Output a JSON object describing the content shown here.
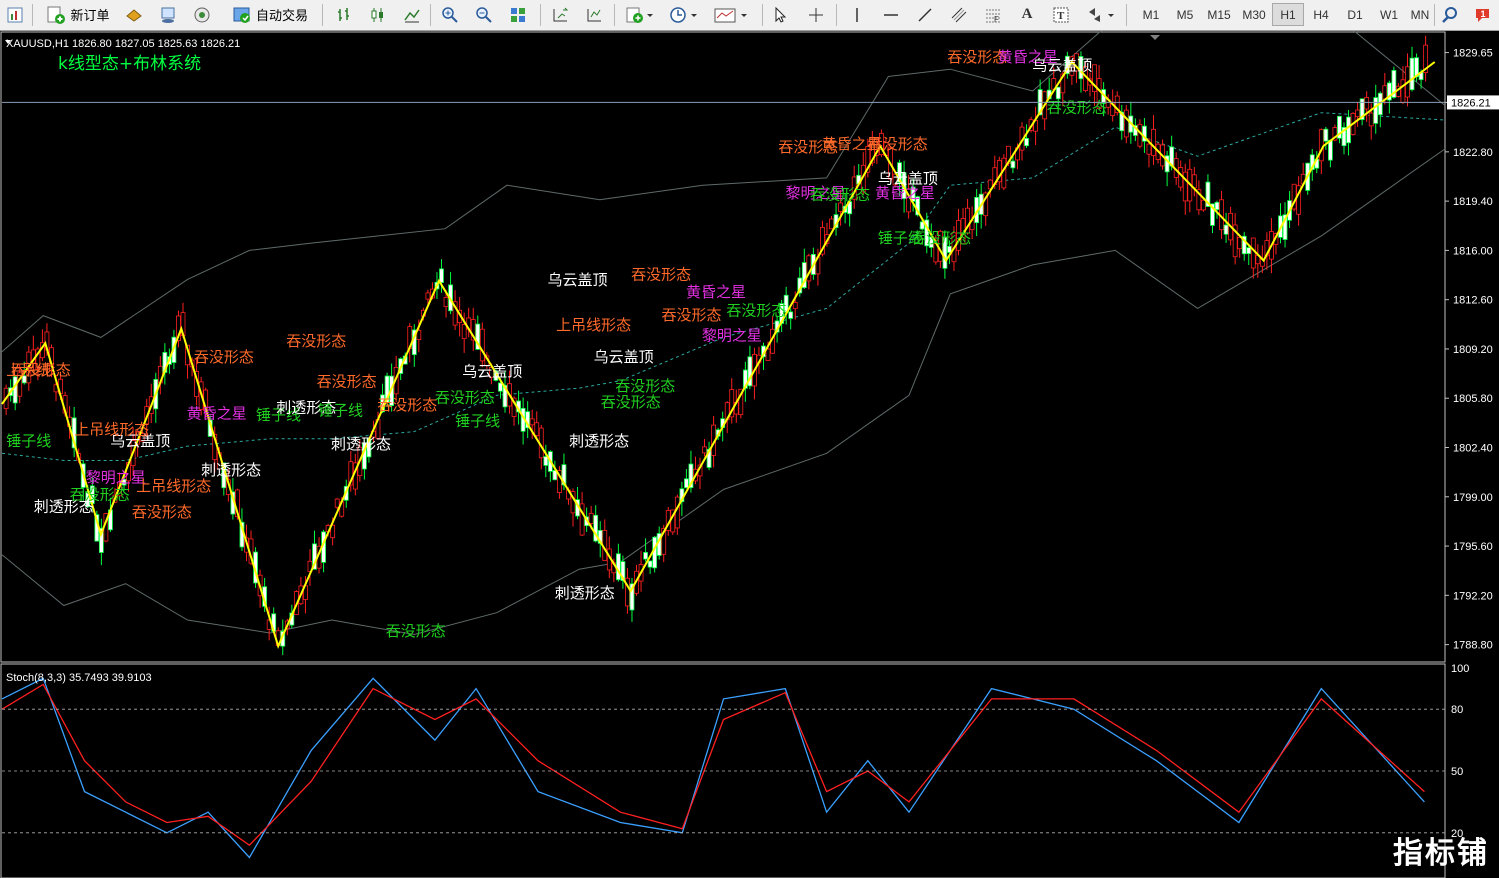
{
  "toolbar": {
    "new_order_label": "新订单",
    "auto_trade_label": "自动交易",
    "timeframes": [
      "M1",
      "M5",
      "M15",
      "M30",
      "H1",
      "H4",
      "D1",
      "W1",
      "MN"
    ]
  },
  "chart": {
    "symbol_info": "XAUUSD,H1  1826.80 1827.05 1825.63 1826.21",
    "indicator_title": "k线型态+布林系统",
    "current_price_label": "1826.21",
    "current_price": 1826.21,
    "price_ticks": [
      "1829.65",
      "1826.21",
      "1822.80",
      "1819.40",
      "1816.00",
      "1812.60",
      "1809.20",
      "1805.80",
      "1802.40",
      "1799.00",
      "1795.60",
      "1792.20",
      "1788.80"
    ],
    "stoch_title": "Stoch(8,3,3) 35.7493 39.9103",
    "stoch_ticks": [
      "100",
      "80",
      "50",
      "20"
    ]
  },
  "chart_data": {
    "type": "line",
    "title": "k线型态+布林系统",
    "xlabel": "",
    "ylabel": "",
    "ylim": [
      1787.6,
      1831.0
    ],
    "zigzag": {
      "x": [
        0,
        21,
        48,
        87,
        134,
        212,
        305,
        426,
        458,
        519,
        612,
        641,
        695
      ],
      "y": [
        1805.4,
        1809.6,
        1796.4,
        1810.6,
        1788.7,
        1813.9,
        1792.5,
        1823.2,
        1815.3,
        1829.0,
        1815.3,
        1823.2,
        1829.0
      ]
    },
    "upper_band": {
      "x": [
        0,
        20,
        48,
        90,
        120,
        150,
        215,
        245,
        290,
        340,
        400,
        430,
        460,
        500,
        540,
        600,
        640,
        700
      ],
      "y": [
        1809.0,
        1811.5,
        1810.0,
        1814.0,
        1816.0,
        1816.5,
        1817.5,
        1820.5,
        1819.5,
        1820.5,
        1821.0,
        1828.0,
        1828.5,
        1827.0,
        1832.0,
        1834.0,
        1833.0,
        1826.0
      ]
    },
    "lower_band": {
      "x": [
        0,
        30,
        60,
        90,
        130,
        160,
        200,
        240,
        280,
        300,
        350,
        400,
        440,
        460,
        500,
        540,
        580,
        640,
        700
      ],
      "y": [
        1795.0,
        1791.5,
        1793.0,
        1790.5,
        1789.6,
        1790.5,
        1789.5,
        1791.0,
        1794.0,
        1794.5,
        1799.5,
        1802.0,
        1806.0,
        1813.0,
        1815.0,
        1816.0,
        1812.0,
        1817.0,
        1823.0
      ]
    },
    "middle_band": {
      "x": [
        0,
        30,
        60,
        90,
        130,
        160,
        200,
        240,
        280,
        300,
        350,
        400,
        440,
        460,
        500,
        540,
        580,
        640,
        700
      ],
      "y": [
        1802.0,
        1801.5,
        1801.5,
        1802.5,
        1803.0,
        1803.0,
        1803.5,
        1806.0,
        1806.5,
        1807.0,
        1810.0,
        1812.0,
        1816.5,
        1820.5,
        1821.0,
        1824.5,
        1822.5,
        1825.5,
        1825.0
      ]
    },
    "stochastic": {
      "ylim": [
        0,
        100
      ],
      "main": {
        "x": [
          0,
          20,
          40,
          60,
          80,
          100,
          120,
          150,
          180,
          210,
          230,
          260,
          300,
          330,
          350,
          380,
          400,
          420,
          440,
          480,
          520,
          560,
          600,
          640,
          690
        ],
        "y": [
          85,
          95,
          40,
          30,
          20,
          30,
          8,
          60,
          95,
          65,
          90,
          40,
          25,
          20,
          85,
          90,
          30,
          55,
          30,
          90,
          80,
          55,
          25,
          90,
          35
        ]
      },
      "signal": {
        "x": [
          0,
          20,
          40,
          60,
          80,
          100,
          120,
          150,
          180,
          210,
          230,
          260,
          300,
          330,
          350,
          380,
          400,
          420,
          440,
          480,
          520,
          560,
          600,
          640,
          690
        ],
        "y": [
          80,
          92,
          55,
          35,
          25,
          28,
          14,
          45,
          90,
          75,
          85,
          55,
          30,
          22,
          75,
          88,
          40,
          50,
          35,
          85,
          85,
          60,
          30,
          85,
          40
        ]
      }
    }
  },
  "annotations": [
    {
      "text": "吞没形态",
      "x": 0.006,
      "price": 1807.4,
      "color": "#ff6a2a"
    },
    {
      "text": "上吊线",
      "x": 0.003,
      "price": 1807.4,
      "color": "#ff6a2a"
    },
    {
      "text": "锤子线",
      "x": 0.003,
      "price": 1802.5,
      "color": "#20d020"
    },
    {
      "text": "乌云盖顶",
      "x": 0.075,
      "price": 1802.5,
      "color": "#ffffff"
    },
    {
      "text": "上吊线形态",
      "x": 0.05,
      "price": 1803.3,
      "color": "#ff6a2a"
    },
    {
      "text": "黎明之星",
      "x": 0.058,
      "price": 1800.0,
      "color": "#e030e0"
    },
    {
      "text": "刺透形态",
      "x": 0.022,
      "price": 1798.0,
      "color": "#ffffff"
    },
    {
      "text": "吞没形态",
      "x": 0.047,
      "price": 1798.8,
      "color": "#20d020"
    },
    {
      "text": "上吊线形态",
      "x": 0.093,
      "price": 1799.4,
      "color": "#ff6a2a"
    },
    {
      "text": "吞没形态",
      "x": 0.09,
      "price": 1797.6,
      "color": "#ff6a2a"
    },
    {
      "text": "刺透形态",
      "x": 0.138,
      "price": 1800.5,
      "color": "#ffffff"
    },
    {
      "text": "吞没形态",
      "x": 0.133,
      "price": 1808.3,
      "color": "#ff6a2a"
    },
    {
      "text": "黄昏之星",
      "x": 0.128,
      "price": 1804.4,
      "color": "#e030e0"
    },
    {
      "text": "锤子线",
      "x": 0.176,
      "price": 1804.3,
      "color": "#20d020"
    },
    {
      "text": "吞没形态",
      "x": 0.197,
      "price": 1809.4,
      "color": "#ff6a2a"
    },
    {
      "text": "刺透形态",
      "x": 0.19,
      "price": 1804.8,
      "color": "#ffffff"
    },
    {
      "text": "吞没形态",
      "x": 0.218,
      "price": 1806.6,
      "color": "#ff6a2a"
    },
    {
      "text": "锤子线",
      "x": 0.219,
      "price": 1804.6,
      "color": "#20d020"
    },
    {
      "text": "刺透形态",
      "x": 0.228,
      "price": 1802.3,
      "color": "#ffffff"
    },
    {
      "text": "吞没形态",
      "x": 0.26,
      "price": 1805.0,
      "color": "#ff6a2a"
    },
    {
      "text": "吞没形态",
      "x": 0.3,
      "price": 1805.5,
      "color": "#20d020"
    },
    {
      "text": "锤子线",
      "x": 0.314,
      "price": 1803.9,
      "color": "#20d020"
    },
    {
      "text": "乌云盖顶",
      "x": 0.319,
      "price": 1807.3,
      "color": "#ffffff"
    },
    {
      "text": "吞没形态",
      "x": 0.266,
      "price": 1789.4,
      "color": "#20d020"
    },
    {
      "text": "乌云盖顶",
      "x": 0.378,
      "price": 1813.6,
      "color": "#ffffff"
    },
    {
      "text": "上吊线形态",
      "x": 0.384,
      "price": 1810.5,
      "color": "#ff6a2a"
    },
    {
      "text": "乌云盖顶",
      "x": 0.41,
      "price": 1808.3,
      "color": "#ffffff"
    },
    {
      "text": "吞没形态",
      "x": 0.425,
      "price": 1806.3,
      "color": "#20d020"
    },
    {
      "text": "吞没形态",
      "x": 0.415,
      "price": 1805.2,
      "color": "#20d020"
    },
    {
      "text": "刺透形态",
      "x": 0.393,
      "price": 1802.5,
      "color": "#ffffff"
    },
    {
      "text": "刺透形态",
      "x": 0.383,
      "price": 1792.0,
      "color": "#ffffff"
    },
    {
      "text": "吞没形态",
      "x": 0.436,
      "price": 1814.0,
      "color": "#ff6a2a"
    },
    {
      "text": "黄昏之星",
      "x": 0.474,
      "price": 1812.8,
      "color": "#e030e0"
    },
    {
      "text": "吞没形态",
      "x": 0.457,
      "price": 1811.2,
      "color": "#ff6a2a"
    },
    {
      "text": "吞没形态",
      "x": 0.502,
      "price": 1811.5,
      "color": "#20d020"
    },
    {
      "text": "黎明之星",
      "x": 0.485,
      "price": 1809.8,
      "color": "#e030e0"
    },
    {
      "text": "吞没形态",
      "x": 0.538,
      "price": 1822.8,
      "color": "#ff6a2a"
    },
    {
      "text": "黄昏之星",
      "x": 0.568,
      "price": 1823.0,
      "color": "#ff6a2a"
    },
    {
      "text": "吞没形态",
      "x": 0.6,
      "price": 1823.0,
      "color": "#ff6a2a"
    },
    {
      "text": "黎明之星",
      "x": 0.543,
      "price": 1819.6,
      "color": "#e030e0"
    },
    {
      "text": "吞没形态",
      "x": 0.56,
      "price": 1819.5,
      "color": "#20d020"
    },
    {
      "text": "乌云盖顶",
      "x": 0.607,
      "price": 1820.6,
      "color": "#ffffff"
    },
    {
      "text": "黄昏之星",
      "x": 0.605,
      "price": 1819.6,
      "color": "#e030e0"
    },
    {
      "text": "锤子线",
      "x": 0.607,
      "price": 1816.5,
      "color": "#20d020"
    },
    {
      "text": "吞没形态",
      "x": 0.63,
      "price": 1816.5,
      "color": "#20d020"
    },
    {
      "text": "吞没形态",
      "x": 0.655,
      "price": 1829.0,
      "color": "#ff6a2a"
    },
    {
      "text": "黄昏之星",
      "x": 0.69,
      "price": 1829.0,
      "color": "#e030e0"
    },
    {
      "text": "乌云盖顶",
      "x": 0.714,
      "price": 1828.4,
      "color": "#ffffff"
    },
    {
      "text": "吞没形态",
      "x": 0.724,
      "price": 1825.5,
      "color": "#20d020"
    }
  ],
  "watermark": "指标铺"
}
